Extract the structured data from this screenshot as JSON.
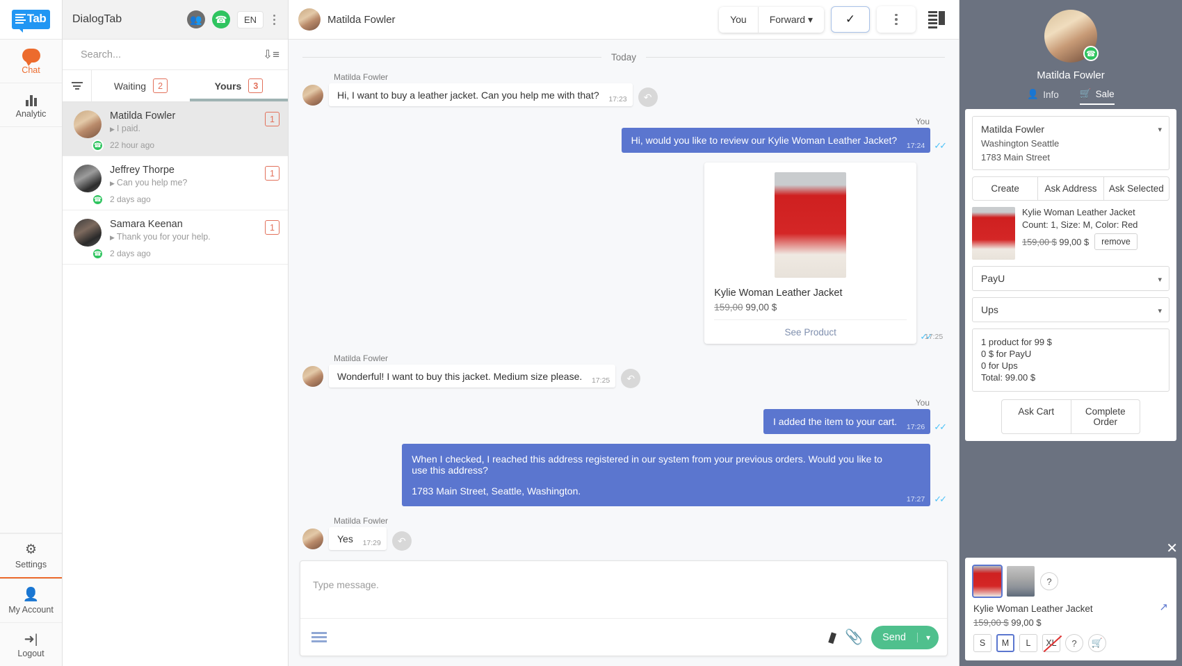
{
  "rail": {
    "logo_text": "Tab",
    "items": [
      {
        "label": "Chat",
        "icon": "chat-bubble-icon",
        "active": true
      },
      {
        "label": "Analytic",
        "icon": "bar-chart-icon",
        "active": false
      }
    ],
    "bottom_items": [
      {
        "label": "Settings",
        "icon": "gear-icon"
      },
      {
        "label": "My Account",
        "icon": "user-icon"
      },
      {
        "label": "Logout",
        "icon": "logout-icon"
      }
    ]
  },
  "list_header": {
    "brand": "DialogTab",
    "group_icon": "group-icon",
    "whatsapp_icon": "whatsapp-icon",
    "language": "EN",
    "kebab_icon": "more-vertical-icon"
  },
  "search": {
    "placeholder": "Search...",
    "value": "",
    "sort_icon": "sort-descending-icon"
  },
  "tabs": {
    "filter_icon": "filter-icon",
    "items": [
      {
        "label": "Waiting",
        "count": "2",
        "active": false
      },
      {
        "label": "Yours",
        "count": "3",
        "active": true
      }
    ]
  },
  "conversations": [
    {
      "name": "Matilda Fowler",
      "preview": "I paid.",
      "time": "22 hour ago",
      "count": "1",
      "selected": true,
      "channel": "whatsapp-icon"
    },
    {
      "name": "Jeffrey Thorpe",
      "preview": "Can you help me?",
      "time": "2 days ago",
      "count": "1",
      "selected": false,
      "channel": "whatsapp-icon"
    },
    {
      "name": "Samara Keenan",
      "preview": "Thank you for your help.",
      "time": "2 days ago",
      "count": "1",
      "selected": false,
      "channel": "whatsapp-icon"
    }
  ],
  "chat_header": {
    "name": "Matilda Fowler",
    "you_label": "You",
    "forward_label": "Forward",
    "chevron_icon": "chevron-down-icon",
    "check_icon": "check-icon",
    "kebab_icon": "more-vertical-icon",
    "panel_toggle_icon": "panel-toggle-icon"
  },
  "chat": {
    "day_separator": "Today",
    "you_label": "You",
    "reply_icon": "reply-icon",
    "ticks_icon": "double-check-icon",
    "messages": [
      {
        "dir": "in",
        "sender": "Matilda Fowler",
        "text": "Hi, I want to buy a leather jacket. Can you help me with that?",
        "time": "17:23"
      },
      {
        "dir": "out",
        "text": "Hi, would you like to review our Kylie Woman Leather Jacket?",
        "time": "17:24"
      },
      {
        "dir": "out-card",
        "time": "17:25"
      },
      {
        "dir": "in",
        "sender": "Matilda Fowler",
        "text": "Wonderful! I want to buy this jacket. Medium size please.",
        "time": "17:25"
      },
      {
        "dir": "out",
        "text": "I added the item to your cart.",
        "time": "17:26"
      },
      {
        "dir": "out-wide",
        "text": "When I checked, I reached this address registered in our system from your previous orders. Would you like to use this address?",
        "text2": "1783 Main Street, Seattle, Washington.",
        "time": "17:27"
      },
      {
        "dir": "in",
        "sender": "Matilda Fowler",
        "text": "Yes",
        "time": "17:29"
      }
    ],
    "product_card": {
      "name": "Kylie Woman Leather Jacket",
      "old_price": "159,00",
      "price": "99,00 $",
      "link": "See Product"
    }
  },
  "composer": {
    "placeholder": "Type message.",
    "menu_icon": "hamburger-menu-icon",
    "quick_icon": "quick-reply-icon",
    "attach_icon": "paperclip-icon",
    "send_label": "Send",
    "send_chevron_icon": "chevron-down-icon"
  },
  "right_panel": {
    "contact_name": "Matilda Fowler",
    "whatsapp_icon": "whatsapp-icon",
    "tabs": [
      {
        "label": "Info",
        "icon": "user-icon",
        "active": false
      },
      {
        "label": "Sale",
        "icon": "cart-icon",
        "active": true
      }
    ],
    "address": {
      "name": "Matilda Fowler",
      "region": "Washington Seattle",
      "street": "1783 Main Street",
      "chevron_icon": "chevron-down-icon"
    },
    "address_actions": [
      "Create",
      "Ask Address",
      "Ask Selected"
    ],
    "cart_item": {
      "title": "Kylie Woman Leather Jacket",
      "meta": "Count: 1, Size: M, Color: Red",
      "old_price": "159,00 $",
      "price": "99,00 $",
      "remove_label": "remove"
    },
    "payment": {
      "value": "PayU",
      "chevron_icon": "chevron-down-icon"
    },
    "shipping": {
      "value": "Ups",
      "chevron_icon": "chevron-down-icon"
    },
    "summary": [
      "1 product for 99 $",
      "0 $ for PayU",
      "0 for Ups",
      "Total: 99.00 $"
    ],
    "cart_actions": [
      "Ask Cart",
      "Complete Order"
    ],
    "footer": {
      "close_icon": "close-icon",
      "external_icon": "external-link-icon",
      "help_icon": "question-mark-icon",
      "cart_icon": "cart-icon",
      "title": "Kylie Woman Leather Jacket",
      "old_price": "159,00 $",
      "price": "99,00 $",
      "sizes": [
        {
          "label": "S",
          "state": "normal"
        },
        {
          "label": "M",
          "state": "selected"
        },
        {
          "label": "L",
          "state": "normal"
        },
        {
          "label": "XL",
          "state": "out-of-stock"
        }
      ],
      "help_label": "?"
    }
  },
  "colors": {
    "accent_orange": "#ec6b2d",
    "brand_blue": "#2196f3",
    "outgoing_bubble": "#5b76cf",
    "send_green": "#4fc08d",
    "whatsapp_green": "#2fc45f",
    "badge_red": "#e2705a",
    "right_panel_bg": "#6b7280"
  }
}
